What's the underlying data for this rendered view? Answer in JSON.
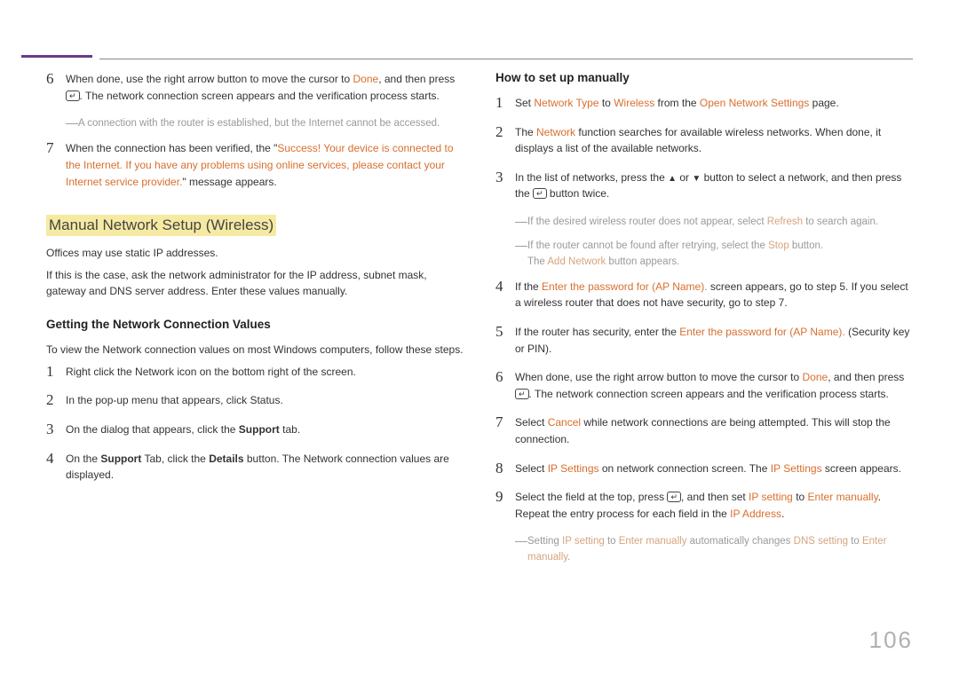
{
  "pageNumber": "106",
  "left": {
    "step6_a": "When done, use the right arrow button to move the cursor to ",
    "step6_done": "Done",
    "step6_b": ", and then press ",
    "step6_c": ". The network connection screen appears and the verification process starts.",
    "note1": "A connection with the router is established, but the Internet cannot be accessed.",
    "step7_a": "When the connection has been verified, the \"",
    "step7_hl": "Success! Your device is connected to the Internet. If you have any problems using online services, please contact your Internet service provider.",
    "step7_b": "\" message appears.",
    "hTitle": "Manual Network Setup (Wireless)",
    "p1": "Offices may use static IP addresses.",
    "p2": "If this is the case, ask the network administrator for the IP address, subnet mask, gateway and DNS server address. Enter these values manually.",
    "h3a": "Getting the Network Connection Values",
    "p3": "To view the Network connection values on most Windows computers, follow these steps.",
    "g1": "Right click the Network icon on the bottom right of the screen.",
    "g2": "In the pop-up menu that appears, click Status.",
    "g3_a": "On the dialog that appears, click the ",
    "g3_b": " tab.",
    "g3_support": "Support",
    "g4_a": "On the ",
    "g4_support": "Support",
    "g4_b": " Tab, click the ",
    "g4_details": "Details",
    "g4_c": " button. The Network connection values are displayed."
  },
  "right": {
    "h3b": "How to set up manually",
    "r1_a": "Set ",
    "r1_nt": "Network Type",
    "r1_b": " to ",
    "r1_w": "Wireless",
    "r1_c": " from the ",
    "r1_ons": "Open Network Settings",
    "r1_d": " page.",
    "r2_a": "The ",
    "r2_net": "Network",
    "r2_b": " function searches for available wireless networks. When done, it displays a list of the available networks.",
    "r3_a": "In the list of networks, press the ",
    "r3_b": " or ",
    "r3_c": " button to select a network, and then press the ",
    "r3_d": " button twice.",
    "rnote1_a": "If the desired wireless router does not appear, select ",
    "rnote1_refresh": "Refresh",
    "rnote1_b": " to search again.",
    "rnote2_a": "If the router cannot be found after retrying, select the ",
    "rnote2_stop": "Stop",
    "rnote2_b": " button.",
    "rnote2_line2_a": "The ",
    "rnote2_add": "Add Network",
    "rnote2_line2_b": " button appears.",
    "r4_a": "If the ",
    "r4_pw": "Enter the password for (AP Name).",
    "r4_b": " screen appears, go to step 5. If you select a wireless router that does not have security, go to step 7.",
    "r5_a": "If the router has security, enter the ",
    "r5_pw": "Enter the password for (AP Name).",
    "r5_b": " (Security key or PIN).",
    "r6_a": "When done, use the right arrow button to move the cursor to ",
    "r6_done": "Done",
    "r6_b": ", and then press ",
    "r6_c": ". The network connection screen appears and the verification process starts.",
    "r7_a": "Select ",
    "r7_cancel": "Cancel",
    "r7_b": " while network connections are being attempted. This will stop the connection.",
    "r8_a": "Select ",
    "r8_ip": "IP Settings",
    "r8_b": " on network connection screen. The ",
    "r8_ip2": "IP Settings",
    "r8_c": " screen appears.",
    "r9_a": "Select the field at the top, press ",
    "r9_b": ", and then set ",
    "r9_ips": "IP setting",
    "r9_c": " to ",
    "r9_em": "Enter manually",
    "r9_d": ". Repeat the entry process for each field in the ",
    "r9_ipa": "IP Address",
    "r9_e": ".",
    "rnote3_a": "Setting ",
    "rnote3_ips": "IP setting",
    "rnote3_b": " to ",
    "rnote3_em": "Enter manually",
    "rnote3_c": " automatically changes ",
    "rnote3_dns": "DNS setting",
    "rnote3_d": " to ",
    "rnote3_em2": "Enter manually",
    "rnote3_e": "."
  }
}
